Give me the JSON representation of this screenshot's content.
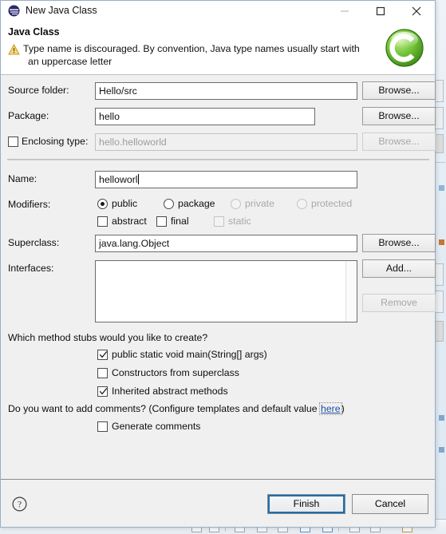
{
  "window": {
    "title": "New Java Class",
    "icon": "eclipse-icon",
    "controls": {
      "minimize": "minimize-icon",
      "maximize": "maximize-icon",
      "close": "close-icon"
    }
  },
  "header": {
    "title": "Java Class",
    "warning_icon": "warning-icon",
    "message_line1": "Type name is discouraged. By convention, Java type names usually start with",
    "message_line2": "an uppercase letter",
    "page_logo": "java-class-logo"
  },
  "form": {
    "source_folder": {
      "label": "Source folder:",
      "value": "Hello/src",
      "browse": "Browse..."
    },
    "package": {
      "label": "Package:",
      "value": "hello",
      "browse": "Browse..."
    },
    "enclosing_type": {
      "label": "Enclosing type:",
      "value": "hello.helloworld",
      "browse": "Browse...",
      "checked": false,
      "enabled": false
    },
    "name": {
      "label": "Name:",
      "value": "helloworl"
    },
    "modifiers": {
      "label": "Modifiers:",
      "access": [
        {
          "label": "public",
          "selected": true,
          "enabled": true
        },
        {
          "label": "package",
          "selected": false,
          "enabled": true
        },
        {
          "label": "private",
          "selected": false,
          "enabled": false
        },
        {
          "label": "protected",
          "selected": false,
          "enabled": false
        }
      ],
      "flags": [
        {
          "label": "abstract",
          "checked": false,
          "enabled": true
        },
        {
          "label": "final",
          "checked": false,
          "enabled": true
        },
        {
          "label": "static",
          "checked": false,
          "enabled": false
        }
      ]
    },
    "superclass": {
      "label": "Superclass:",
      "value": "java.lang.Object",
      "browse": "Browse..."
    },
    "interfaces": {
      "label": "Interfaces:",
      "items": [],
      "add": "Add...",
      "remove": "Remove"
    }
  },
  "stubs": {
    "question": "Which method stubs would you like to create?",
    "options": [
      {
        "label": "public static void main(String[] args)",
        "checked": true
      },
      {
        "label": "Constructors from superclass",
        "checked": false
      },
      {
        "label": "Inherited abstract methods",
        "checked": true
      }
    ]
  },
  "comments": {
    "question_prefix": "Do you want to add comments? (Configure templates and default value ",
    "link": "here",
    "question_suffix": ")",
    "generate": {
      "label": "Generate comments",
      "checked": false
    }
  },
  "footer": {
    "help_icon": "help-icon",
    "finish": "Finish",
    "cancel": "Cancel"
  },
  "colors": {
    "accent": "#1a6fb5",
    "link": "#1b4ea8",
    "warning": "#f0ad2e",
    "logo_green": "#69c242",
    "dialog_bg": "#f0f0f0",
    "header_bg": "#ffffff"
  }
}
